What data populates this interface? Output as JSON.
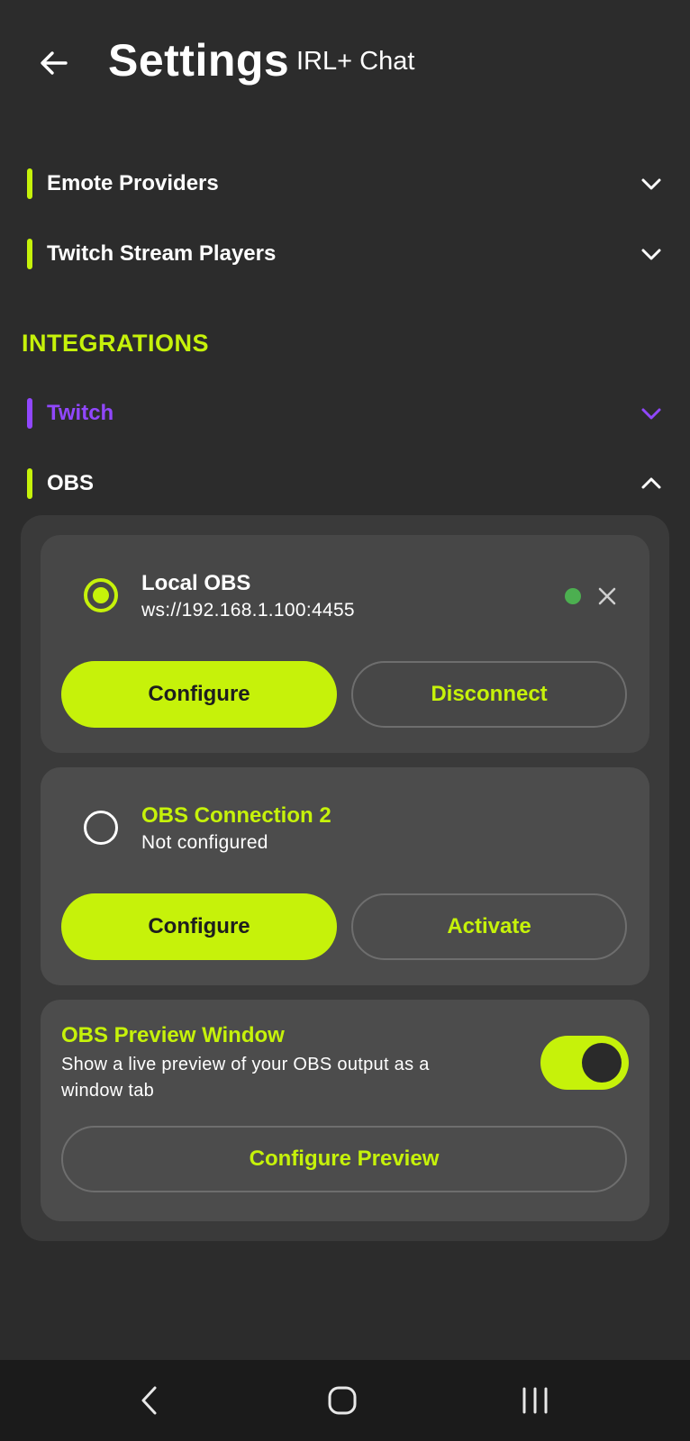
{
  "header": {
    "title": "Settings",
    "subtitle": "IRL+ Chat"
  },
  "sections": {
    "emote_providers": "Emote Providers",
    "twitch_stream_players": "Twitch Stream Players",
    "integrations_heading": "INTEGRATIONS",
    "twitch": "Twitch",
    "obs": "OBS"
  },
  "obs": {
    "connections": [
      {
        "name": "Local OBS",
        "url": "ws://192.168.1.100:4455",
        "selected": true,
        "connected": true,
        "primary_label": "Configure",
        "secondary_label": "Disconnect"
      },
      {
        "name": "OBS Connection 2",
        "url": "Not configured",
        "selected": false,
        "connected": false,
        "primary_label": "Configure",
        "secondary_label": "Activate"
      }
    ],
    "preview": {
      "title": "OBS Preview Window",
      "description": "Show a live preview of your OBS output as a window tab",
      "enabled": true,
      "button_label": "Configure Preview"
    }
  },
  "colors": {
    "accent": "#c6f20a",
    "twitch": "#9147ff",
    "status_connected": "#4caf50",
    "background": "#2c2c2c"
  },
  "icons": {
    "back": "arrow-left-icon",
    "expand": "chevron-down-icon",
    "collapse": "chevron-up-icon",
    "remove": "close-icon",
    "nav_back": "nav-back-icon",
    "nav_home": "nav-home-icon",
    "nav_recents": "nav-recents-icon"
  }
}
